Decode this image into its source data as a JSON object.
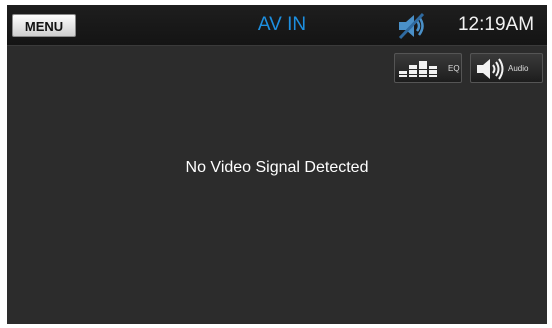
{
  "header": {
    "menu_label": "MENU",
    "title": "AV IN",
    "clock": "12:19AM"
  },
  "toolbar": {
    "eq_label": "EQ",
    "audio_label": "Audio"
  },
  "main": {
    "message": "No Video Signal Detected"
  },
  "icons": {
    "mute": "muted-speaker-icon",
    "eq": "equalizer-icon",
    "audio": "speaker-icon"
  },
  "colors": {
    "title": "#1d8fe0",
    "background": "#2c2c2c"
  }
}
